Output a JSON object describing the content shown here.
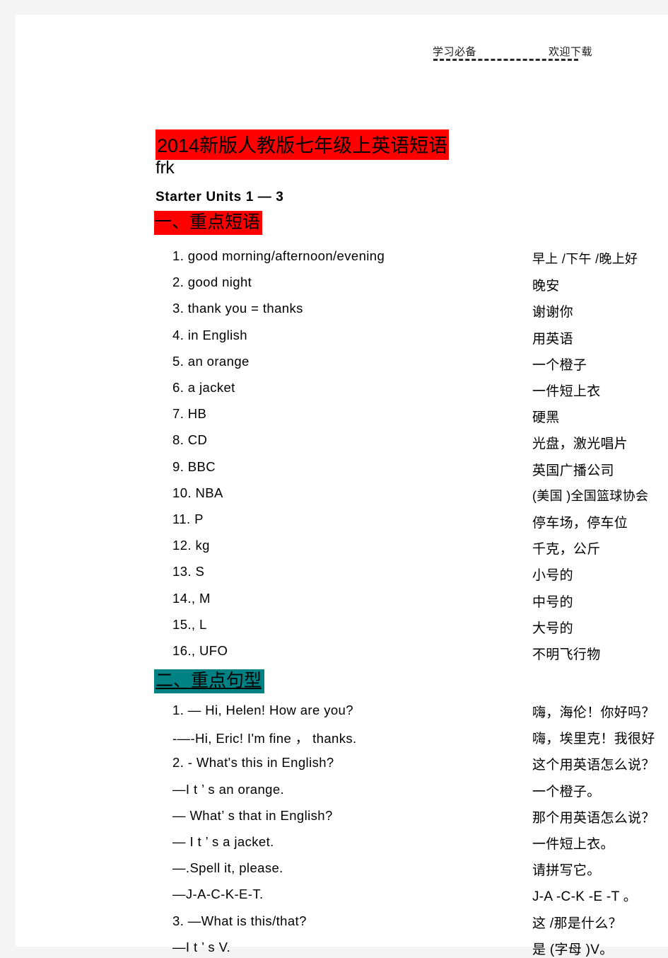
{
  "header": {
    "left_text": "学习必备",
    "right_text": "欢迎下载"
  },
  "document": {
    "title": "2014新版人教版七年级上英语短语",
    "subtitle": "frk",
    "unit_heading": "Starter Units 1 — 3",
    "colors": {
      "title_highlight": "#ff0000",
      "section1_highlight": "#ff0000",
      "section2_highlight": "#008284",
      "page_background": "#ffffff",
      "canvas_background": "#f4f4f4",
      "text": "#000000"
    }
  },
  "section1": {
    "heading": "一、重点短语",
    "entries": [
      {
        "num": "1.",
        "en": "good morning/afternoon/evening",
        "zh": "早上 /下午 /晚上好"
      },
      {
        "num": "2.",
        "en": "good night",
        "zh": "晚安"
      },
      {
        "num": "3.",
        "en": "thank you = thanks",
        "zh": "谢谢你"
      },
      {
        "num": "4.",
        "en": "in English",
        "zh": "用英语"
      },
      {
        "num": "5.",
        "en": "an orange",
        "zh": "一个橙子"
      },
      {
        "num": "6.",
        "en": "a jacket",
        "zh": "一件短上衣"
      },
      {
        "num": "7.",
        "en": "HB",
        "zh": "硬黑"
      },
      {
        "num": "8.",
        "en": "CD",
        "zh": "光盘，激光唱片"
      },
      {
        "num": "9.",
        "en": "BBC",
        "zh": "英国广播公司"
      },
      {
        "num": "10.",
        "en": "NBA",
        "zh": "(美国 )全国篮球协会"
      },
      {
        "num": "11.",
        "en": "P",
        "zh": "停车场，停车位"
      },
      {
        "num": "12.",
        "en": "kg",
        "zh": "千克，公斤"
      },
      {
        "num": "13.",
        "en": "S",
        "zh": "小号的"
      },
      {
        "num": "14.,",
        "en": "M",
        "zh": "中号的"
      },
      {
        "num": "15.,",
        "en": "L",
        "zh": "大号的"
      },
      {
        "num": "16.,",
        "en": "UFO",
        "zh": "不明飞行物"
      }
    ]
  },
  "section2": {
    "heading": "二、重点句型",
    "lines": [
      {
        "en": "1. — Hi, Helen! How are you?",
        "zh": "嗨，海伦！你好吗？"
      },
      {
        "en": "-—-Hi, Eric! I'm fine ，  thanks.",
        "zh": "嗨，埃里克！我很好"
      },
      {
        "en": "2. - What's this in English?",
        "zh": "这个用英语怎么说？"
      },
      {
        "en": "—I t  ’ s an orange.",
        "zh": "一个橙子。"
      },
      {
        "en": "— What’ s that in English?",
        "zh": "那个用英语怎么说？"
      },
      {
        "en": "— I t   ’ s a jacket.",
        "zh": "一件短上衣。"
      },
      {
        "en": "—.Spell it, please.",
        "zh": "请拼写它。"
      },
      {
        "en": "—J-A-C-K-E-T.",
        "zh": "J-A -C-K -E -T 。"
      },
      {
        "en": "3. —What is this/that?",
        "zh": "这 /那是什么？"
      },
      {
        "en": "—I t  ’ s V.",
        "zh": "是 (字母 )V。"
      }
    ]
  }
}
